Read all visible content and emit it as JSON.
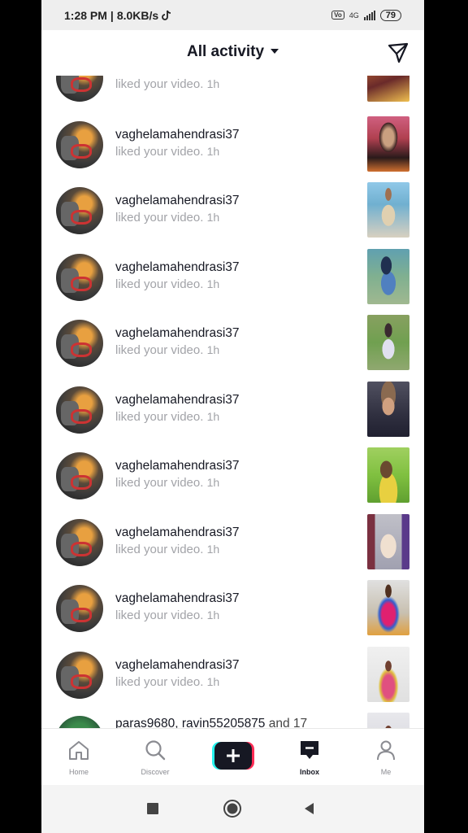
{
  "status_bar": {
    "time": "1:28 PM",
    "speed": "8.0KB/s",
    "volte": "Vo",
    "net": "4G",
    "battery": "79"
  },
  "header": {
    "title": "All activity"
  },
  "partial_top": {
    "text": "liked your video.",
    "time": "1h"
  },
  "rows": [
    {
      "username": "vaghelamahendrasi37",
      "text": "liked your video.",
      "time": "1h"
    },
    {
      "username": "vaghelamahendrasi37",
      "text": "liked your video.",
      "time": "1h"
    },
    {
      "username": "vaghelamahendrasi37",
      "text": "liked your video.",
      "time": "1h"
    },
    {
      "username": "vaghelamahendrasi37",
      "text": "liked your video.",
      "time": "1h"
    },
    {
      "username": "vaghelamahendrasi37",
      "text": "liked your video.",
      "time": "1h"
    },
    {
      "username": "vaghelamahendrasi37",
      "text": "liked your video.",
      "time": "1h"
    },
    {
      "username": "vaghelamahendrasi37",
      "text": "liked your video.",
      "time": "1h"
    },
    {
      "username": "vaghelamahendrasi37",
      "text": "liked your video.",
      "time": "1h"
    },
    {
      "username": "vaghelamahendrasi37",
      "text": "liked your video.",
      "time": "1h"
    }
  ],
  "partial_bottom": {
    "users": "paras9680, ravin55205875",
    "suffix": "and 17"
  },
  "nav": {
    "home": "Home",
    "discover": "Discover",
    "inbox": "Inbox",
    "me": "Me"
  },
  "colors": {
    "accent_cyan": "#25f4ee",
    "accent_red": "#fe2c55",
    "text_primary": "#161823",
    "text_secondary": "#a2a3a8"
  }
}
